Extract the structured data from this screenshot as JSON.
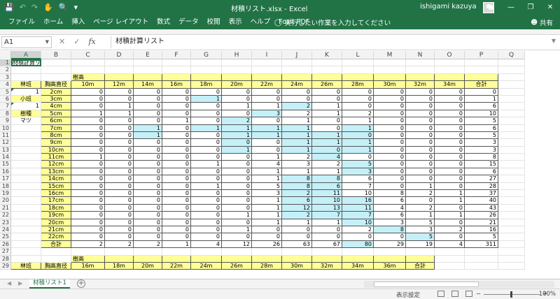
{
  "window": {
    "title": "材積リスト.xlsx  -  Excel",
    "user": "ishigami kazuya"
  },
  "ribbon": {
    "tabs": [
      "ファイル",
      "ホーム",
      "挿入",
      "ページ レイアウト",
      "数式",
      "データ",
      "校閲",
      "表示",
      "ヘルプ",
      "Foxit PDF"
    ],
    "tell_me": "実行したい作業を入力してください",
    "share": "共有"
  },
  "formula_bar": {
    "name_box": "A1",
    "formula": "材積計算リスト"
  },
  "columns": [
    "A",
    "B",
    "C",
    "D",
    "E",
    "F",
    "G",
    "H",
    "I",
    "J",
    "K",
    "L",
    "M",
    "N",
    "O",
    "P",
    "Q"
  ],
  "sheet": {
    "title_cell": "材積計算リスト",
    "header_label": "樹高",
    "col_label": "胸高直径",
    "heights": [
      "10m",
      "12m",
      "14m",
      "16m",
      "18m",
      "20m",
      "22m",
      "24m",
      "26m",
      "28m",
      "30m",
      "32m",
      "34m",
      "合計"
    ],
    "side_labels": {
      "r5": "林班",
      "r5v": "1",
      "r6": "小班",
      "r7v": "1",
      "r8": "樹種",
      "r9": "マツ"
    },
    "diameters": [
      "2cm",
      "3cm",
      "4cm",
      "5cm",
      "6cm",
      "7cm",
      "8cm",
      "9cm",
      "10cm",
      "11cm",
      "12cm",
      "13cm",
      "14cm",
      "15cm",
      "16cm",
      "17cm",
      "18cm",
      "19cm",
      "20cm",
      "21cm",
      "22cm"
    ],
    "values": [
      [
        0,
        0,
        0,
        0,
        0,
        0,
        0,
        0,
        0,
        0,
        0,
        0,
        0,
        0
      ],
      [
        0,
        0,
        0,
        0,
        1,
        0,
        0,
        0,
        0,
        0,
        0,
        0,
        0,
        1
      ],
      [
        0,
        1,
        0,
        0,
        0,
        1,
        1,
        2,
        1,
        0,
        0,
        0,
        0,
        6
      ],
      [
        1,
        1,
        0,
        0,
        0,
        0,
        3,
        2,
        1,
        2,
        0,
        0,
        0,
        10
      ],
      [
        0,
        0,
        0,
        1,
        0,
        2,
        0,
        1,
        0,
        1,
        0,
        0,
        0,
        5
      ],
      [
        0,
        0,
        1,
        0,
        1,
        1,
        1,
        1,
        0,
        1,
        0,
        0,
        0,
        6
      ],
      [
        0,
        0,
        1,
        0,
        0,
        1,
        1,
        1,
        1,
        0,
        0,
        0,
        0,
        5
      ],
      [
        0,
        0,
        0,
        0,
        0,
        0,
        0,
        1,
        1,
        1,
        0,
        0,
        0,
        3
      ],
      [
        0,
        0,
        0,
        0,
        0,
        1,
        0,
        1,
        0,
        1,
        0,
        0,
        0,
        3
      ],
      [
        1,
        0,
        0,
        0,
        0,
        0,
        1,
        2,
        4,
        0,
        0,
        0,
        0,
        8
      ],
      [
        0,
        0,
        0,
        0,
        1,
        0,
        4,
        3,
        2,
        5,
        0,
        0,
        0,
        15
      ],
      [
        0,
        0,
        0,
        0,
        0,
        0,
        1,
        1,
        1,
        3,
        0,
        0,
        0,
        6
      ],
      [
        0,
        0,
        0,
        0,
        0,
        0,
        1,
        8,
        8,
        6,
        0,
        0,
        0,
        27
      ],
      [
        0,
        0,
        0,
        0,
        1,
        0,
        5,
        8,
        6,
        7,
        0,
        1,
        0,
        28
      ],
      [
        0,
        0,
        0,
        0,
        0,
        0,
        3,
        2,
        11,
        10,
        8,
        2,
        1,
        37
      ],
      [
        0,
        0,
        0,
        0,
        0,
        0,
        1,
        6,
        10,
        16,
        6,
        0,
        1,
        40
      ],
      [
        0,
        0,
        0,
        0,
        0,
        0,
        1,
        12,
        13,
        11,
        4,
        2,
        0,
        43
      ],
      [
        0,
        0,
        0,
        0,
        0,
        1,
        1,
        2,
        7,
        7,
        6,
        1,
        1,
        26
      ],
      [
        0,
        0,
        0,
        0,
        0,
        0,
        1,
        1,
        1,
        10,
        3,
        5,
        0,
        21
      ],
      [
        0,
        0,
        0,
        0,
        0,
        1,
        0,
        0,
        0,
        2,
        8,
        3,
        2,
        16
      ],
      [
        0,
        0,
        0,
        0,
        0,
        0,
        0,
        0,
        0,
        0,
        0,
        5,
        0,
        5
      ]
    ],
    "highlights": [
      [],
      [
        4
      ],
      [
        7
      ],
      [
        6
      ],
      [
        5
      ],
      [
        2,
        4,
        5,
        6,
        7,
        9
      ],
      [
        2,
        5,
        6,
        7,
        8,
        9
      ],
      [
        5,
        7,
        8,
        9
      ],
      [
        5,
        7,
        8,
        9
      ],
      [
        8
      ],
      [
        9
      ],
      [
        9
      ],
      [
        7,
        8
      ],
      [
        7,
        8
      ],
      [
        7,
        8
      ],
      [
        7,
        8,
        9
      ],
      [
        7,
        8,
        9
      ],
      [
        7,
        8,
        9
      ],
      [
        9
      ],
      [
        10
      ],
      [
        11
      ]
    ],
    "total_label": "合計",
    "totals": [
      2,
      2,
      2,
      1,
      4,
      12,
      26,
      63,
      67,
      80,
      29,
      19,
      4,
      311
    ],
    "total_highlights": [
      9
    ],
    "block2": {
      "header_label": "樹高",
      "side_label": "林班",
      "col_label": "胸高直径",
      "heights": [
        "16m",
        "18m",
        "20m",
        "22m",
        "24m",
        "26m",
        "28m",
        "30m",
        "32m",
        "34m",
        "36m",
        "合計"
      ]
    }
  },
  "sheet_tabs": [
    "材積リスト1"
  ],
  "status": {
    "display_settings": "表示設定",
    "zoom": "100%"
  }
}
